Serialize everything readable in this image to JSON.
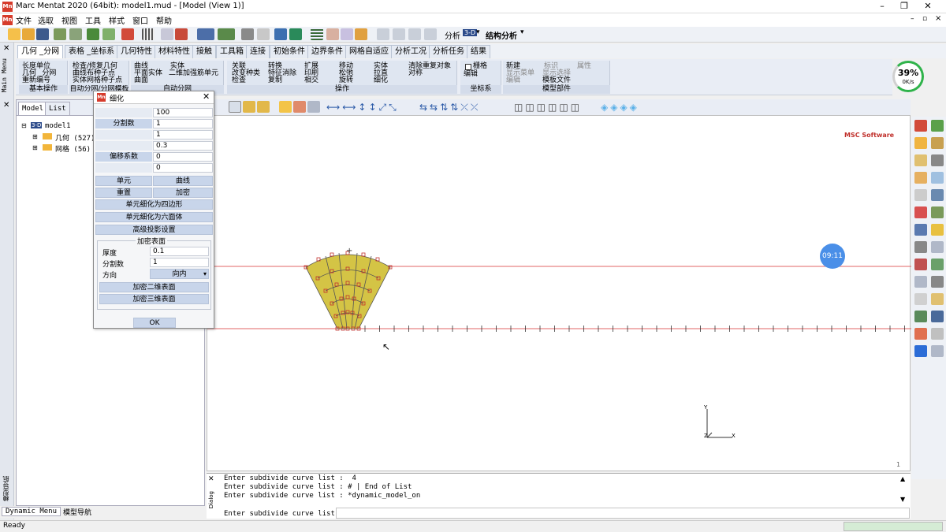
{
  "window": {
    "title": "Marc Mentat 2020 (64bit): model1.mud - [Model (View 1)]",
    "controls": [
      "–",
      "❐",
      "✕"
    ],
    "mdi_controls": [
      "–",
      "▫",
      "×"
    ]
  },
  "menubar": {
    "items": [
      "文件",
      "选取",
      "视图",
      "工具",
      "样式",
      "窗口",
      "帮助"
    ]
  },
  "toolbar": {
    "analysis_label": "分析",
    "view_mode": "3-D",
    "analysis_type": "结构分析"
  },
  "tabs": [
    "几何 _分网",
    "表格 _坐标系",
    "几何特性",
    "材料特性",
    "接触",
    "工具箱",
    "连接",
    "初始条件",
    "边界条件",
    "网格自适应",
    "分析工况",
    "分析任务",
    "结果"
  ],
  "ribbon": {
    "groups": [
      {
        "label": "基本操作",
        "items": [
          "长度单位",
          "几何 _分网",
          "重新编号"
        ]
      },
      {
        "label": "自动分网/分网模板",
        "items": [
          "检查/修复几何",
          "曲线布种子点",
          "实体网格种子点",
          "自动分网/分网模板"
        ]
      },
      {
        "label": "自动分网",
        "items": [
          "曲线",
          "平面实体",
          "曲面",
          "实体",
          "二维加强筋单元"
        ]
      },
      {
        "label": "操作",
        "items": [
          "关联",
          "改变种类",
          "检查",
          "转换",
          "特征消除",
          "复制",
          "扩展",
          "印刷",
          "相交",
          "移动",
          "松弛",
          "旋转",
          "实体",
          "拉直",
          "细化",
          "清除重复对象",
          "对称"
        ]
      },
      {
        "label": "坐标系",
        "items": [
          "栅格",
          "编辑"
        ]
      },
      {
        "label": "模型部件",
        "items": [
          "新建",
          "显示菜单",
          "编辑",
          "标识",
          "显示选择",
          "模板文件",
          "属性"
        ]
      }
    ]
  },
  "speed_widget": {
    "percent": "39%",
    "rate": "0K/s"
  },
  "tree": {
    "tabs": [
      "Model",
      "List"
    ],
    "root": "model1",
    "root_badge": "3-D",
    "children": [
      {
        "label": "几何 (527)"
      },
      {
        "label": "网格 (56)"
      }
    ]
  },
  "left_strip": {
    "main_menu": "Main Menu",
    "model_nav": "模型导航"
  },
  "bottom_tabs": [
    "Dynamic Menu",
    "模型导航"
  ],
  "viewport": {
    "brand": "MSC Software",
    "time_badge": "09:11",
    "page_number": "1",
    "axis": {
      "y": "Y",
      "x": "X",
      "z": "Z"
    }
  },
  "modal": {
    "title": "细化",
    "fields": [
      {
        "label": "",
        "value": "100"
      },
      {
        "label": "分割数",
        "value": "1"
      },
      {
        "label": "",
        "value": "1"
      },
      {
        "label": "",
        "value": "0.3"
      },
      {
        "label": "偏移系数",
        "value": "0"
      },
      {
        "label": "",
        "value": "0"
      }
    ],
    "buttons": {
      "element": "单元",
      "curve": "曲线",
      "reset": "重置",
      "refine": "加密",
      "quad": "单元细化为四边形",
      "hex": "单元细化为六面体",
      "advanced": "高级投影设置"
    },
    "dense_surface": {
      "title": "加密表面",
      "thickness_label": "厚度",
      "thickness_value": "0.1",
      "divisions_label": "分割数",
      "divisions_value": "1",
      "direction_label": "方向",
      "direction_value": "向内",
      "btn_2d": "加密二维表面",
      "btn_3d": "加密三维表面"
    },
    "ok": "OK"
  },
  "dialog": {
    "label": "Dialog",
    "lines": [
      "Enter subdivide curve list :  4",
      "Enter subdivide curve list : # | End of List",
      "Enter subdivide curve list : *dynamic_model_on"
    ],
    "prompt": "Enter subdivide curve list :"
  },
  "status": {
    "text": "Ready"
  },
  "colors": {
    "accent": "#2b6cd6",
    "mesh": "#d4c445",
    "line": "#e06666",
    "node": "#c0302b"
  }
}
